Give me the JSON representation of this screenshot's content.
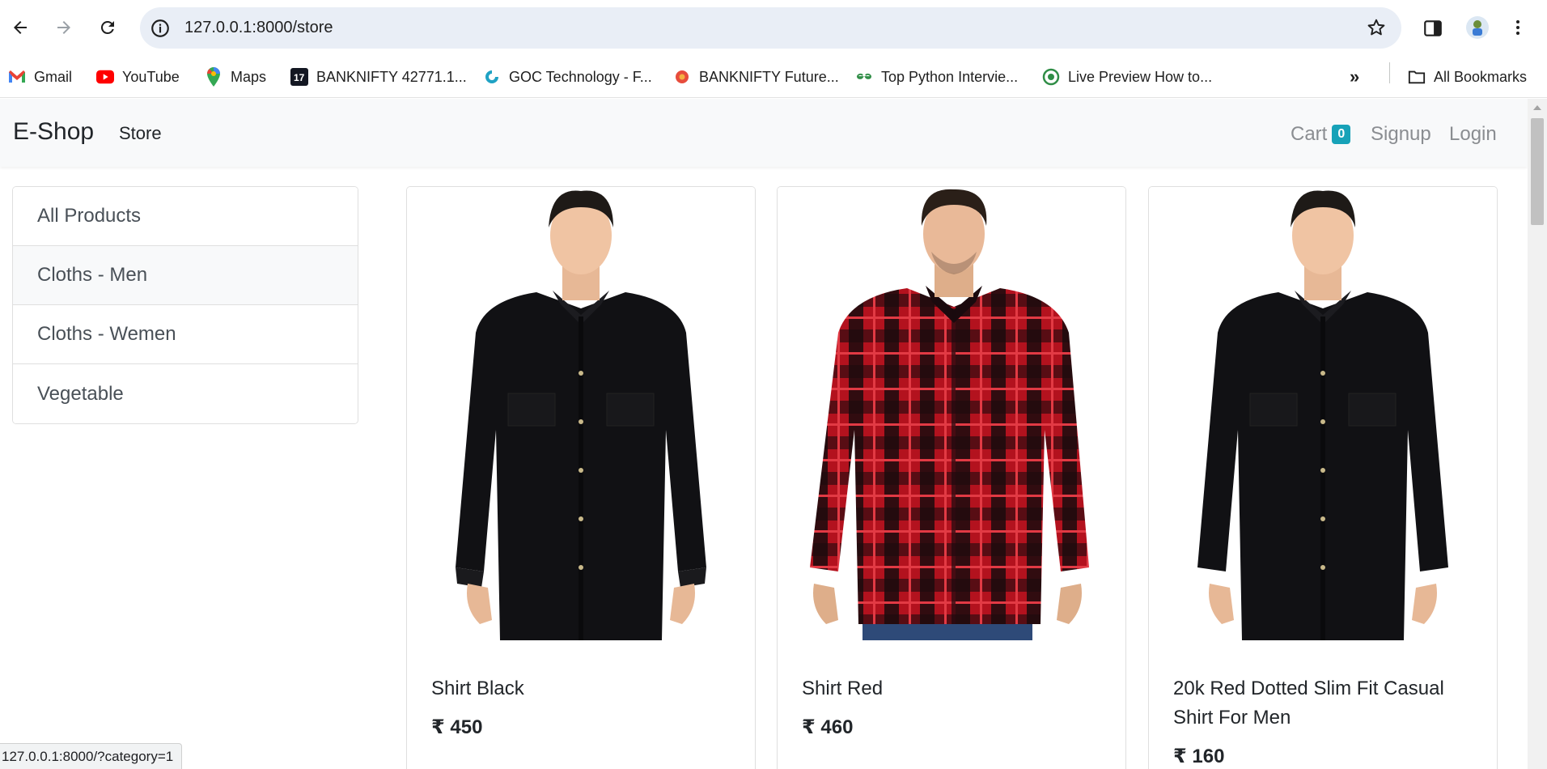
{
  "browser": {
    "url": "127.0.0.1:8000/store",
    "bookmarks": [
      {
        "label": "Gmail",
        "icon": "gmail-icon"
      },
      {
        "label": "YouTube",
        "icon": "youtube-icon"
      },
      {
        "label": "Maps",
        "icon": "maps-icon"
      },
      {
        "label": "BANKNIFTY 42771.1...",
        "icon": "tradingview-icon"
      },
      {
        "label": "GOC Technology - F...",
        "icon": "goc-icon"
      },
      {
        "label": "BANKNIFTY Future...",
        "icon": "chart-icon"
      },
      {
        "label": "Top Python Intervie...",
        "icon": "geeksforgeeks-icon"
      },
      {
        "label": "Live Preview How to...",
        "icon": "live-preview-icon"
      }
    ],
    "all_bookmarks_label": "All Bookmarks",
    "status_text": "127.0.0.1:8000/?category=1"
  },
  "navbar": {
    "brand": "E-Shop",
    "store_link": "Store",
    "cart_label": "Cart",
    "cart_count": "0",
    "signup": "Signup",
    "login": "Login"
  },
  "categories": [
    {
      "label": "All Products"
    },
    {
      "label": "Cloths - Men"
    },
    {
      "label": "Cloths - Wemen"
    },
    {
      "label": "Vegetable"
    }
  ],
  "products": [
    {
      "name": "Shirt Black",
      "price": "₹ 450",
      "shirt_color": "black"
    },
    {
      "name": "Shirt Red",
      "price": "₹ 460",
      "shirt_color": "red-plaid"
    },
    {
      "name": "20k Red Dotted Slim Fit Casual Shirt For Men",
      "price": "₹ 160",
      "shirt_color": "black"
    }
  ],
  "colors": {
    "badge": "#17a2b8",
    "navbar_bg": "#f8f9fa"
  }
}
